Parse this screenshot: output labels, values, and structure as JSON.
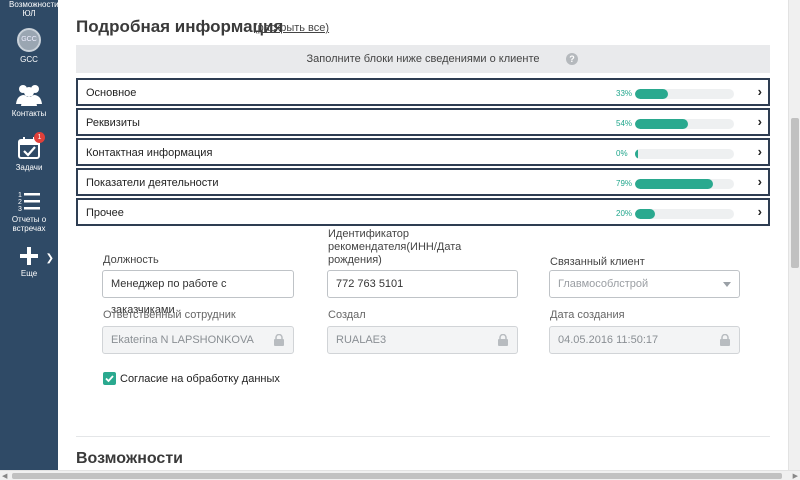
{
  "sidebar": {
    "top_label": "Возможности ЮЛ",
    "items": [
      {
        "label": "GCC",
        "icon": "gcc-avatar-icon",
        "avatar_text": "GCC"
      },
      {
        "label": "Контакты",
        "icon": "contacts-icon"
      },
      {
        "label": "Задачи",
        "icon": "tasks-icon",
        "badge": "1"
      },
      {
        "label": "Отчеты о встречах",
        "icon": "meeting-reports-icon"
      },
      {
        "label": "Еще",
        "icon": "plus-icon"
      }
    ]
  },
  "details": {
    "title": "Подробная информация",
    "expand_all": "(раскрыть все)",
    "hint": "Заполните блоки ниже сведениями о клиенте",
    "help_icon": "?",
    "blocks": [
      {
        "label": "Основное",
        "percent": "33%",
        "progress": 0.33
      },
      {
        "label": "Реквизиты",
        "percent": "54%",
        "progress": 0.54
      },
      {
        "label": "Контактная информация",
        "percent": "0%",
        "progress": 0.0
      },
      {
        "label": "Показатели деятельности",
        "percent": "79%",
        "progress": 0.79
      },
      {
        "label": "Прочее",
        "percent": "20%",
        "progress": 0.2
      }
    ]
  },
  "fields": {
    "position": {
      "label": "Должность",
      "value": "Менеджер по работе с заказчиками"
    },
    "referrer": {
      "label": "Идентификатор рекомендателя(ИНН/Дата рождения)",
      "value": "772 763 5101"
    },
    "linked_client": {
      "label": "Связанный клиент",
      "value": "Главмособлстрой"
    },
    "responsible": {
      "label": "Ответственный сотрудник",
      "value": "Ekaterina N LAPSHONKOVA"
    },
    "created_by": {
      "label": "Создал",
      "value": "RUALAE3"
    },
    "created_date": {
      "label": "Дата создания",
      "value": "04.05.2016 11:50:17"
    }
  },
  "consent": {
    "label": "Согласие на обработку данных",
    "checked": true
  },
  "next_section": {
    "title": "Возможности"
  },
  "colors": {
    "sidebar": "#2f4a66",
    "accent": "#2aa98f",
    "block_border": "#2e3d52",
    "badge": "#e0403a"
  }
}
